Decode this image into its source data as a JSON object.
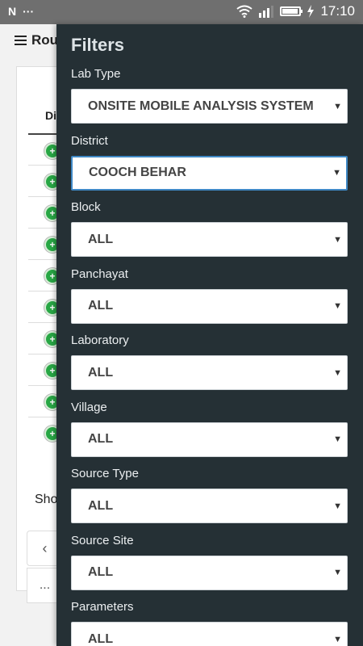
{
  "status_bar": {
    "left_icons": [
      "notification-n-icon",
      "more-dots-icon"
    ],
    "left_text": "N",
    "dots": "···",
    "time": "17:10",
    "battery_level": 0.9,
    "icons": [
      "wifi-icon",
      "signal-icon",
      "battery-icon",
      "charging-icon"
    ]
  },
  "background": {
    "header_title": "Rou",
    "column_header": "Di",
    "row_count": 10,
    "row_button_symbol": "+",
    "footer_text": "Sho",
    "pager_prev": "‹",
    "pager_ellipsis": "..."
  },
  "drawer": {
    "title": "Filters",
    "filters": [
      {
        "label": "Lab Type",
        "value": "ONSITE MOBILE ANALYSIS SYSTEM",
        "focused": false
      },
      {
        "label": "District",
        "value": "COOCH BEHAR",
        "focused": true
      },
      {
        "label": "Block",
        "value": "ALL",
        "focused": false
      },
      {
        "label": "Panchayat",
        "value": "ALL",
        "focused": false
      },
      {
        "label": "Laboratory",
        "value": "ALL",
        "focused": false
      },
      {
        "label": "Village",
        "value": "ALL",
        "focused": false
      },
      {
        "label": "Source Type",
        "value": "ALL",
        "focused": false
      },
      {
        "label": "Source Site",
        "value": "ALL",
        "focused": false
      },
      {
        "label": "Parameters",
        "value": "ALL",
        "focused": false
      }
    ]
  }
}
